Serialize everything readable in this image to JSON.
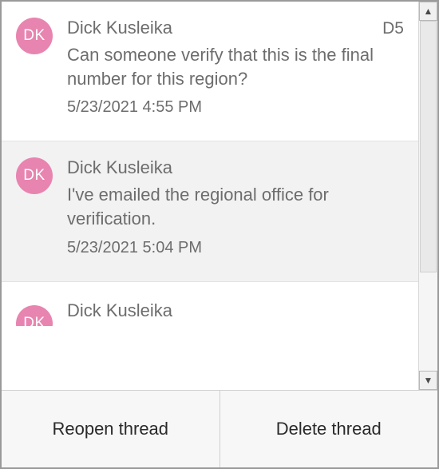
{
  "comments": [
    {
      "initials": "DK",
      "author": "Dick Kusleika",
      "cell_ref": "D5",
      "text": "Can someone verify that this is the final number for this region?",
      "timestamp": "5/23/2021 4:55 PM"
    },
    {
      "initials": "DK",
      "author": "Dick Kusleika",
      "cell_ref": "",
      "text": "I've emailed the regional office for verification.",
      "timestamp": "5/23/2021 5:04 PM"
    },
    {
      "initials": "DK",
      "author": "Dick Kusleika",
      "cell_ref": "",
      "text": "",
      "timestamp": ""
    }
  ],
  "footer": {
    "reopen_label": "Reopen thread",
    "delete_label": "Delete thread"
  },
  "scrollbar": {
    "up_glyph": "▲",
    "down_glyph": "▼"
  }
}
